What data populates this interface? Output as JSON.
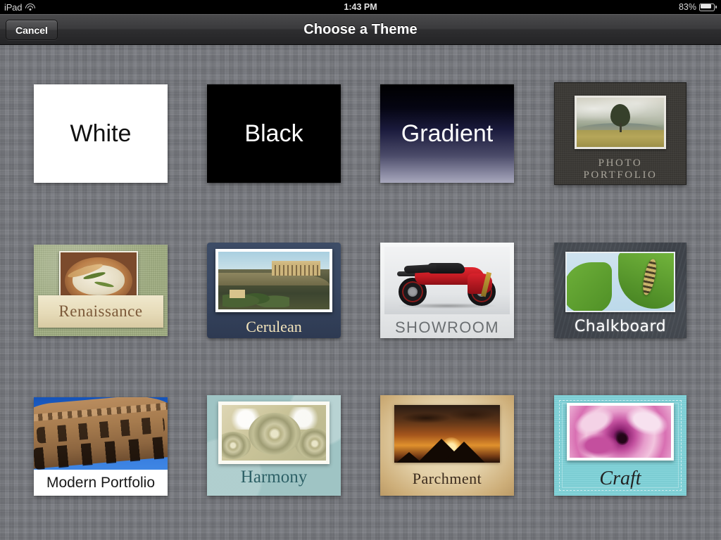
{
  "statusbar": {
    "carrier": "iPad",
    "wifi_icon": "wifi-icon",
    "time": "1:43 PM",
    "battery_percent": "83%",
    "battery_icon": "battery-icon",
    "battery_level": 83
  },
  "navbar": {
    "title": "Choose a Theme",
    "cancel_label": "Cancel"
  },
  "colors": {
    "background": "#787a80",
    "navbar": "#3a3a3c",
    "statusbar": "#000000",
    "accent_white": "#ffffff"
  },
  "themes": [
    {
      "name": "White",
      "label": "White",
      "style": "t-white"
    },
    {
      "name": "Black",
      "label": "Black",
      "style": "t-black"
    },
    {
      "name": "Gradient",
      "label": "Gradient",
      "style": "t-gradient"
    },
    {
      "name": "Photo Portfolio",
      "label": "PHOTO PORTFOLIO",
      "style": "t-photoport"
    },
    {
      "name": "Renaissance",
      "label": "Renaissance",
      "style": "t-renaissance"
    },
    {
      "name": "Cerulean",
      "label": "Cerulean",
      "style": "t-cerulean"
    },
    {
      "name": "Showroom",
      "label": "SHOWROOM",
      "style": "t-showroom"
    },
    {
      "name": "Chalkboard",
      "label": "Chalkboard",
      "style": "t-chalkboard"
    },
    {
      "name": "Modern Portfolio",
      "label": "Modern Portfolio",
      "style": "t-modernport"
    },
    {
      "name": "Harmony",
      "label": "Harmony",
      "style": "t-harmony"
    },
    {
      "name": "Parchment",
      "label": "Parchment",
      "style": "t-parchment"
    },
    {
      "name": "Craft",
      "label": "Craft",
      "style": "t-craft"
    }
  ]
}
